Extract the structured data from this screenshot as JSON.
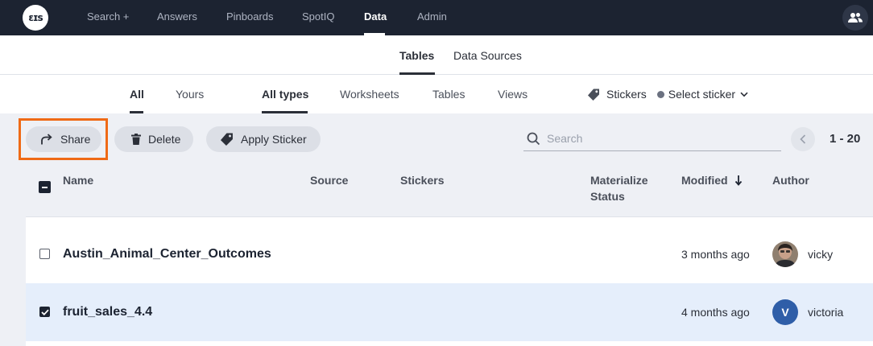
{
  "topnav": {
    "logo_text": "ɛɪs",
    "items": [
      {
        "label": "Search +"
      },
      {
        "label": "Answers"
      },
      {
        "label": "Pinboards"
      },
      {
        "label": "SpotIQ"
      },
      {
        "label": "Data",
        "active": true
      },
      {
        "label": "Admin"
      }
    ],
    "user_icon": "users-icon"
  },
  "subnav": {
    "items": [
      {
        "label": "Tables",
        "active": true
      },
      {
        "label": "Data Sources"
      }
    ]
  },
  "filters": {
    "ownership": [
      {
        "label": "All",
        "active": true
      },
      {
        "label": "Yours"
      }
    ],
    "types": [
      {
        "label": "All types",
        "active": true
      },
      {
        "label": "Worksheets"
      },
      {
        "label": "Tables"
      },
      {
        "label": "Views"
      }
    ],
    "stickers_label": "Stickers",
    "select_sticker_label": "Select sticker"
  },
  "toolbar": {
    "share_label": "Share",
    "delete_label": "Delete",
    "apply_sticker_label": "Apply Sticker",
    "search_placeholder": "Search",
    "pagination": "1 - 20",
    "highlight_color": "#ef6a16"
  },
  "table": {
    "columns": {
      "name": "Name",
      "source": "Source",
      "stickers": "Stickers",
      "materialize_1": "Materialize",
      "materialize_2": "Status",
      "modified": "Modified",
      "author": "Author"
    },
    "rows": [
      {
        "name": "Austin_Animal_Center_Outcomes",
        "modified": "3 months ago",
        "author": "vicky",
        "avatar": "photo",
        "selected": false
      },
      {
        "name": "fruit_sales_4.4",
        "modified": "4 months ago",
        "author": "victoria",
        "avatar_letter": "V",
        "selected": true
      }
    ]
  }
}
